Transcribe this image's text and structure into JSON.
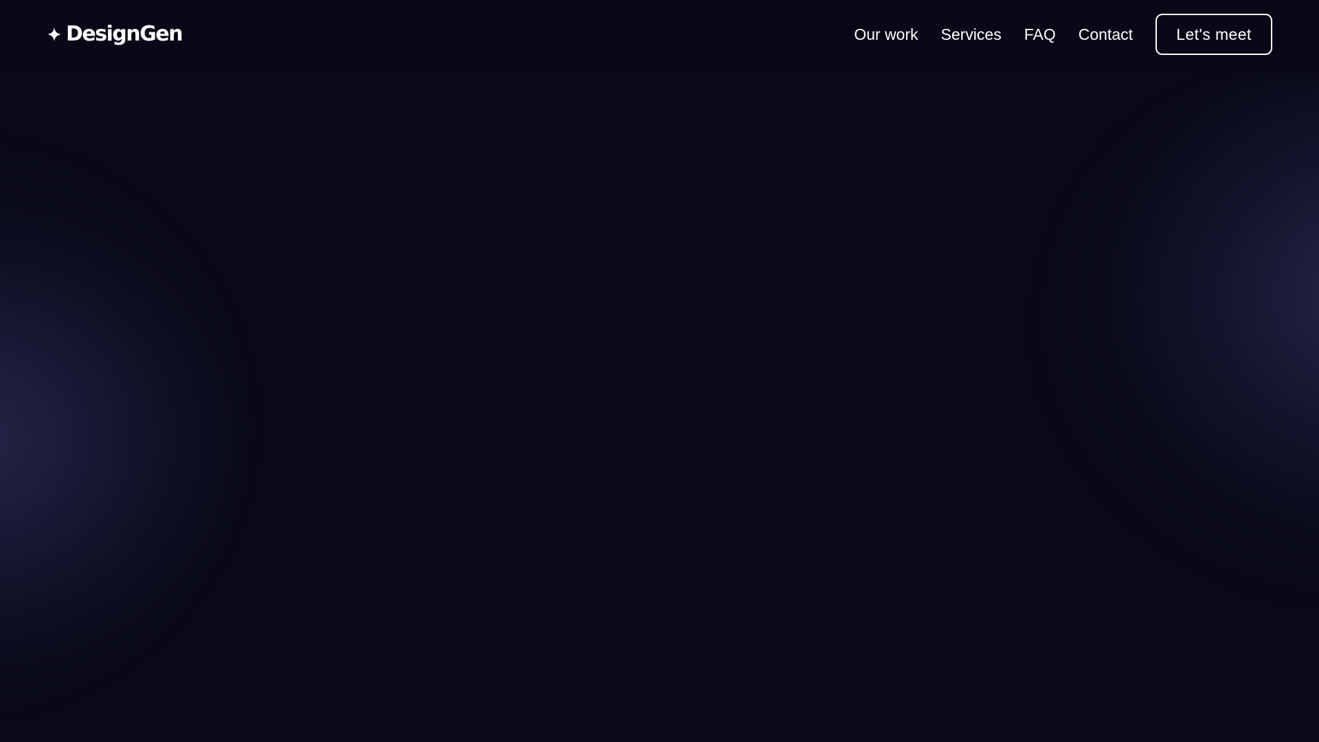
{
  "theme": {
    "background": "#090918",
    "text": "#ffffff",
    "glow": "#2a2c56"
  },
  "header": {
    "brand": {
      "name": "DesignGen",
      "icon": "sparkle-icon"
    },
    "nav": [
      {
        "label": "Our work"
      },
      {
        "label": "Services"
      },
      {
        "label": "FAQ"
      },
      {
        "label": "Contact"
      }
    ],
    "cta_label": "Let's meet"
  }
}
